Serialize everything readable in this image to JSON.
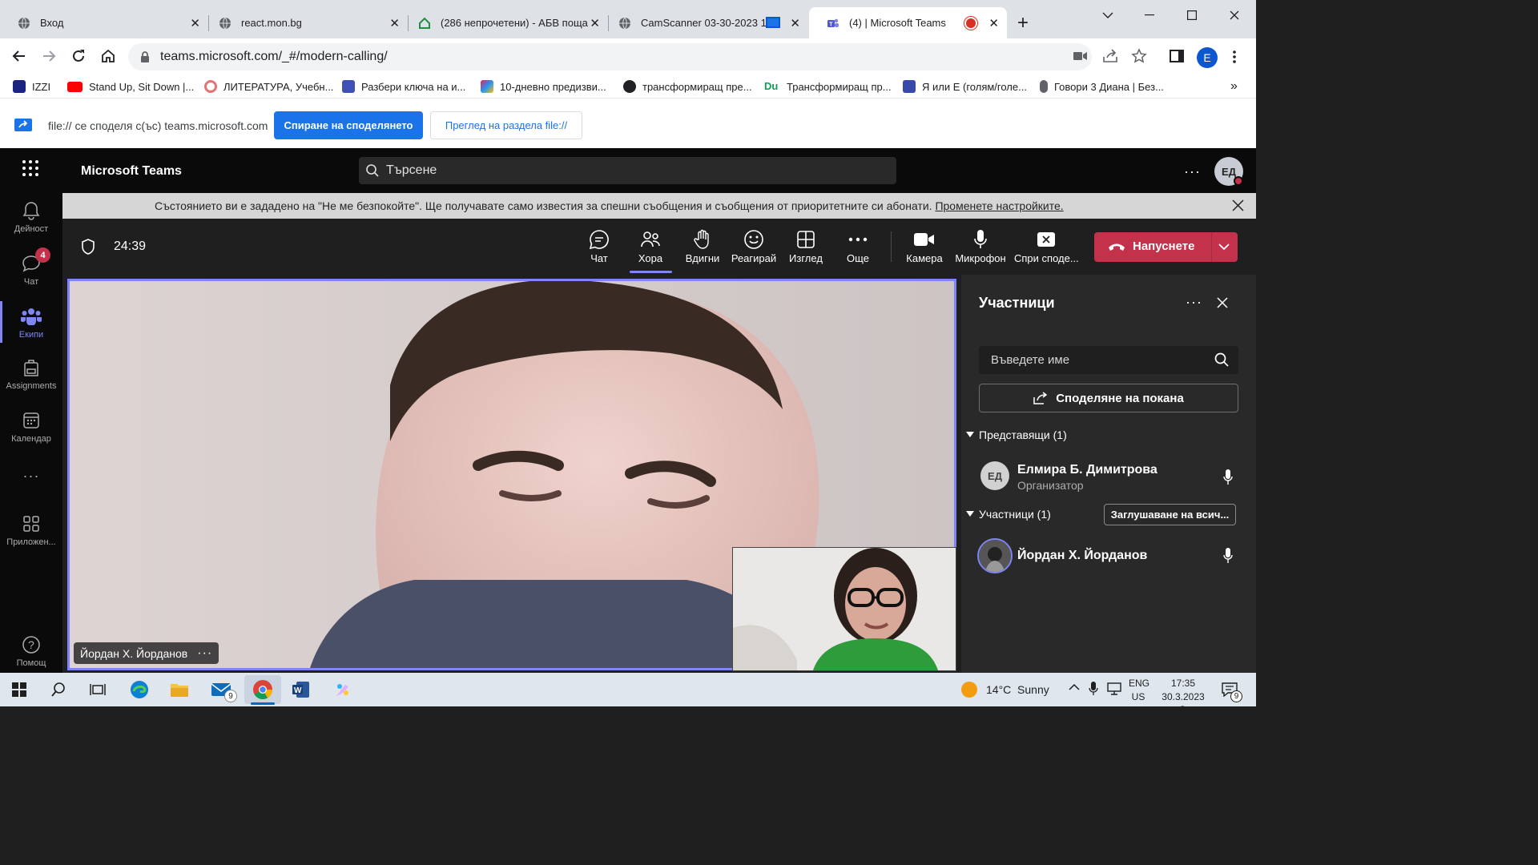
{
  "browser": {
    "tabs": [
      {
        "title": "Вход",
        "icon": "globe-icon"
      },
      {
        "title": "react.mon.bg",
        "icon": "globe-icon"
      },
      {
        "title": "(286 непрочетени) - АБВ поща",
        "icon": "abv-mail-icon"
      },
      {
        "title": "CamScanner 03-30-2023 1",
        "icon": "globe-icon"
      },
      {
        "title": "(4) | Microsoft Teams",
        "icon": "teams-icon",
        "active": true
      }
    ],
    "new_tab": "+",
    "address": "teams.microsoft.com/_#/modern-calling/",
    "profile_initial": "E",
    "bookmarks": [
      {
        "label": "IZZI",
        "icon_color": "#1a237e"
      },
      {
        "label": "Stand Up, Sit Down |...",
        "icon_color": "#ff0000"
      },
      {
        "label": "ЛИТЕРАТУРА, Учебн...",
        "icon_color": "#e57373"
      },
      {
        "label": "Разбери ключа на и...",
        "icon_color": "#3f51b5"
      },
      {
        "label": "10-дневно предизви...",
        "icon_color": "#e91e63"
      },
      {
        "label": "трансформиращ пре...",
        "icon_color": "#202124"
      },
      {
        "label": "Трансформиращ пр...",
        "icon_color": "#0f9d58"
      },
      {
        "label": "Я или Е (голям/голе...",
        "icon_color": "#3949ab"
      },
      {
        "label": "Говори 3 Диана | Без...",
        "icon_color": "#5f6368"
      }
    ],
    "more_bookmarks": "»"
  },
  "share_bar": {
    "text": "file:// се споделя с(ъс) teams.microsoft.com",
    "stop_label": "Спиране на споделянето",
    "view_label": "Преглед на раздела file://"
  },
  "teams": {
    "app_title": "Microsoft Teams",
    "search_placeholder": "Търсене",
    "avatar_initials": "ЕД",
    "rail": [
      {
        "label": "Дейност",
        "icon": "bell-icon"
      },
      {
        "label": "Чат",
        "icon": "chat-icon",
        "badge": "4"
      },
      {
        "label": "Екипи",
        "icon": "teams-icon",
        "active": true
      },
      {
        "label": "Assignments",
        "icon": "backpack-icon"
      },
      {
        "label": "Календар",
        "icon": "calendar-icon"
      },
      {
        "label": "...",
        "icon": "more-icon"
      },
      {
        "label": "Приложен...",
        "icon": "apps-icon"
      },
      {
        "label": "Помощ",
        "icon": "help-icon"
      }
    ],
    "notification": {
      "text": "Състоянието ви е зададено на \"Не ме безпокойте\". Ще получавате само известия за спешни съобщения и съобщения от приоритетните си абонати.",
      "link": "Променете настройките."
    },
    "call": {
      "timer": "24:39",
      "controls": [
        {
          "label": "Чат",
          "icon": "chat-icon"
        },
        {
          "label": "Хора",
          "icon": "people-icon",
          "active": true
        },
        {
          "label": "Вдигни",
          "icon": "raise-hand-icon"
        },
        {
          "label": "Реагирай",
          "icon": "smile-icon"
        },
        {
          "label": "Изглед",
          "icon": "grid-icon"
        },
        {
          "label": "Още",
          "icon": "more-icon"
        },
        {
          "label": "Камера",
          "icon": "camera-icon"
        },
        {
          "label": "Микрофон",
          "icon": "mic-icon"
        },
        {
          "label": "Спри споде...",
          "icon": "stop-share-icon"
        }
      ],
      "leave_label": "Напуснете",
      "main_video_name": "Йордан Х. Йорданов"
    },
    "participants": {
      "title": "Участници",
      "search_placeholder": "Въведете име",
      "invite_label": "Споделяне на покана",
      "presenters_header": "Представящи (1)",
      "presenters": [
        {
          "name": "Елмира Б. Димитрова",
          "role": "Организатор",
          "initials": "ЕД"
        }
      ],
      "attendees_header": "Участници (1)",
      "mute_all_label": "Заглушаване на всич...",
      "attendees": [
        {
          "name": "Йордан Х. Йорданов"
        }
      ]
    }
  },
  "taskbar": {
    "mail_badge": "9",
    "weather": "14°C  Sunny",
    "lang": "ENG",
    "region": "US",
    "time": "17:35",
    "date": "30.3.2023 г.",
    "notif_count": "9"
  }
}
